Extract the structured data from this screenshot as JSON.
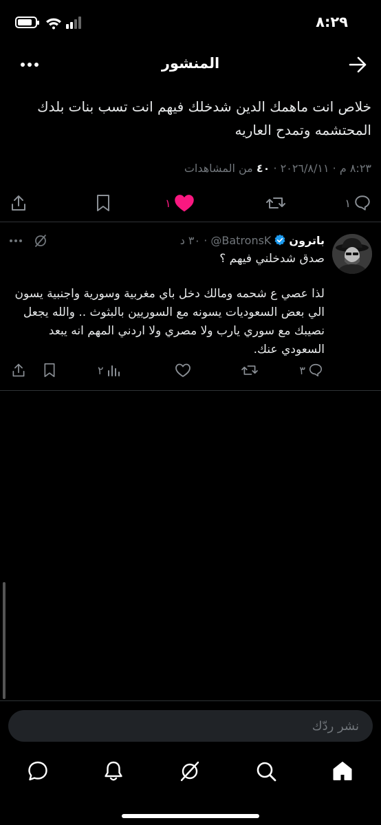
{
  "status_bar": {
    "time": "٨:٢٩"
  },
  "header": {
    "title": "المنشور"
  },
  "post": {
    "text": "خلاص انت ماهمك الدين شدخلك فيهم انت تسب بنات بلدك المحتشمه وتمدح العاريه",
    "date": "٢٠٢٦/٨/١١",
    "time": "٨:٢٣ م",
    "views_count": "٤٠",
    "views_label": "من المشاهدات",
    "replies": "١",
    "likes": "١"
  },
  "reply": {
    "name": "باترون",
    "handle": "@BatronsK",
    "age": "٣٠ د",
    "question": "صدق شدخلني فيهم ؟",
    "body": "لذا عصي ع شحمه ومالك دخل باي مغربية وسورية واجنبية يسون الي بعض السعوديات يسونه مع السوريين بالبثوث .. والله يجعل نصيبك مع سوري يارب ولا مصري ولا اردني المهم انه يبعد السعودي عنك.",
    "replies": "٣",
    "views": "٢"
  },
  "reply_input": {
    "placeholder": "نشر ردّك"
  },
  "colors": {
    "like": "#f91880",
    "verified": "#1d9bf0",
    "muted": "#71767b"
  }
}
